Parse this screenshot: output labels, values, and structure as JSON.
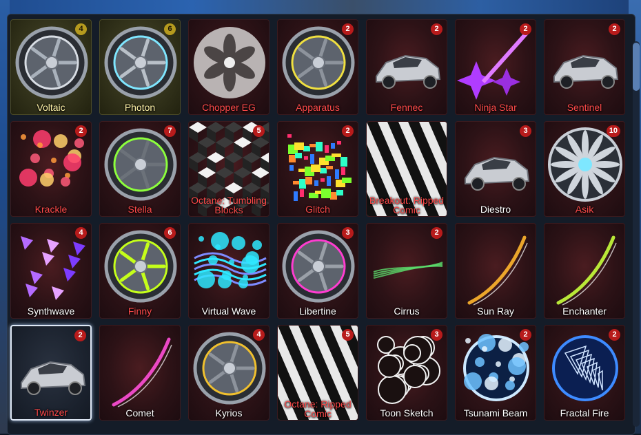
{
  "inventory": {
    "items": [
      {
        "name": "Voltaic",
        "count": "4",
        "style": "gold",
        "label_color": "gold",
        "art": "wheel-lightning-icon"
      },
      {
        "name": "Photon",
        "count": "6",
        "style": "gold",
        "label_color": "gold",
        "art": "wheel-glow-icon"
      },
      {
        "name": "Chopper EG",
        "count": "",
        "style": "normal",
        "label_color": "red",
        "art": "wheel-fan-icon"
      },
      {
        "name": "Apparatus",
        "count": "2",
        "style": "normal",
        "label_color": "red",
        "art": "wheel-yellow-icon"
      },
      {
        "name": "Fennec",
        "count": "2",
        "style": "normal",
        "label_color": "red",
        "art": "car-body-icon"
      },
      {
        "name": "Ninja Star",
        "count": "2",
        "style": "normal",
        "label_color": "red",
        "art": "shuriken-boost-icon"
      },
      {
        "name": "Sentinel",
        "count": "2",
        "style": "normal",
        "label_color": "red",
        "art": "car-body-icon"
      },
      {
        "name": "Krackle",
        "count": "2",
        "style": "normal",
        "label_color": "red",
        "art": "explosion-boost-icon"
      },
      {
        "name": "Stella",
        "count": "7",
        "style": "normal",
        "label_color": "red",
        "art": "wheel-star-icon"
      },
      {
        "name": "Octane: Tumbling Blocks",
        "count": "5",
        "style": "normal",
        "label_color": "red",
        "art": "cube-decal-icon"
      },
      {
        "name": "Glitch",
        "count": "2",
        "style": "normal",
        "label_color": "red",
        "art": "glitch-boost-icon"
      },
      {
        "name": "Breakout: Ripped Comic",
        "count": "",
        "style": "normal",
        "label_color": "red",
        "art": "ripped-decal-icon"
      },
      {
        "name": "Diestro",
        "count": "3",
        "style": "normal",
        "label_color": "white",
        "art": "car-body-icon"
      },
      {
        "name": "Asik",
        "count": "10",
        "style": "normal",
        "label_color": "red",
        "art": "wheel-turbine-icon"
      },
      {
        "name": "Synthwave",
        "count": "4",
        "style": "normal",
        "label_color": "white",
        "art": "triangle-boost-icon"
      },
      {
        "name": "Finny",
        "count": "6",
        "style": "normal",
        "label_color": "red",
        "art": "wheel-lime-icon"
      },
      {
        "name": "Virtual Wave",
        "count": "",
        "style": "normal",
        "label_color": "white",
        "art": "wave-boost-icon"
      },
      {
        "name": "Libertine",
        "count": "3",
        "style": "normal",
        "label_color": "white",
        "art": "wheel-pink-icon"
      },
      {
        "name": "Cirrus",
        "count": "2",
        "style": "normal",
        "label_color": "white",
        "art": "green-trail-icon"
      },
      {
        "name": "Sun Ray",
        "count": "",
        "style": "normal",
        "label_color": "white",
        "art": "sun-trail-icon"
      },
      {
        "name": "Enchanter",
        "count": "",
        "style": "normal",
        "label_color": "white",
        "art": "enchant-trail-icon"
      },
      {
        "name": "Twinzer",
        "count": "2",
        "style": "selected",
        "label_color": "red",
        "art": "car-body-icon"
      },
      {
        "name": "Comet",
        "count": "",
        "style": "normal",
        "label_color": "white",
        "art": "comet-trail-icon"
      },
      {
        "name": "Kyrios",
        "count": "4",
        "style": "normal",
        "label_color": "white",
        "art": "wheel-kyrios-icon"
      },
      {
        "name": "Octane: Ripped Comic",
        "count": "5",
        "style": "normal",
        "label_color": "red",
        "art": "ripped-decal-icon"
      },
      {
        "name": "Toon Sketch",
        "count": "3",
        "style": "normal",
        "label_color": "white",
        "art": "smoke-boost-icon"
      },
      {
        "name": "Tsunami Beam",
        "count": "2",
        "style": "normal",
        "label_color": "white",
        "art": "orb-boost-icon"
      },
      {
        "name": "Fractal Fire",
        "count": "2",
        "style": "normal",
        "label_color": "white",
        "art": "fractal-boost-icon"
      }
    ]
  }
}
